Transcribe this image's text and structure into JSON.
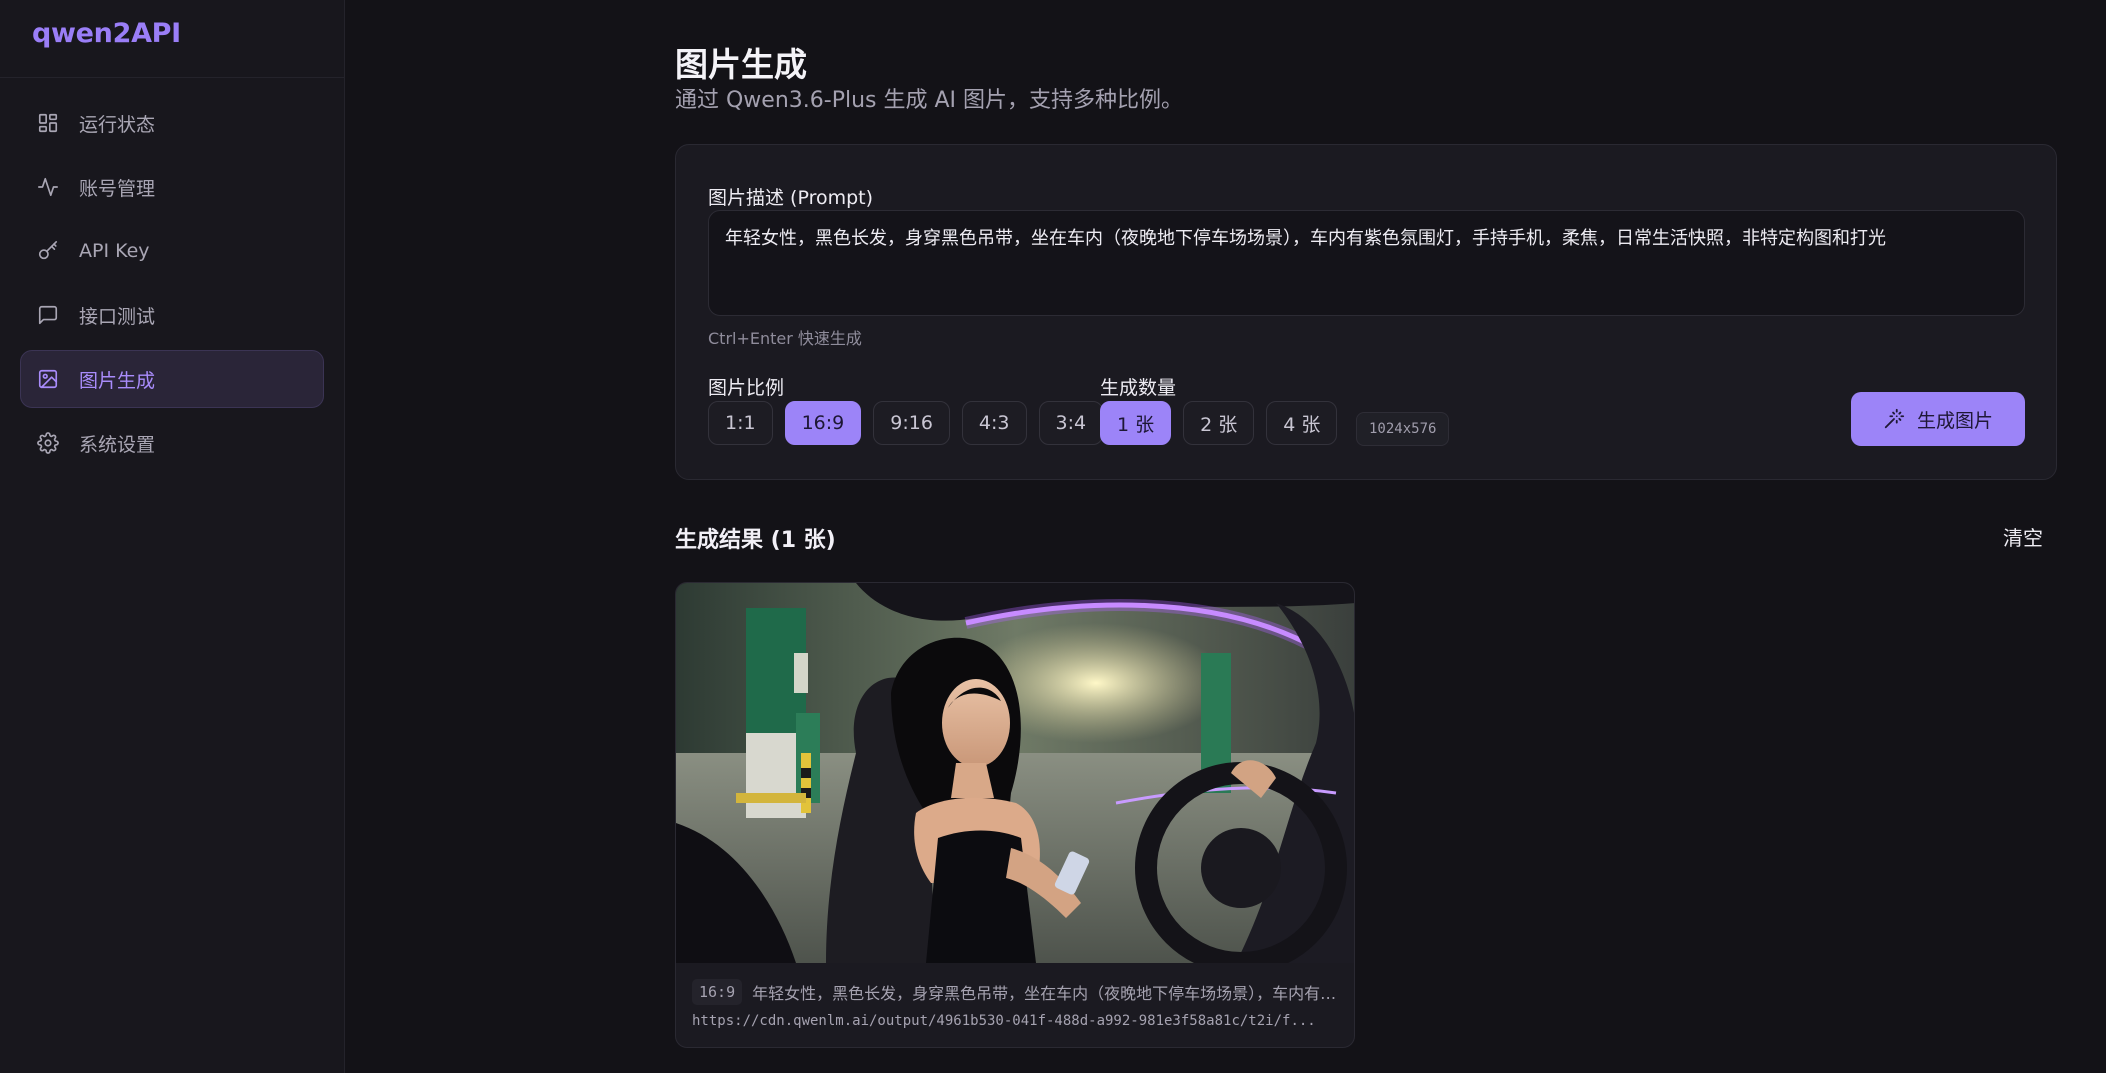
{
  "app": {
    "brand": "qwen2API"
  },
  "sidebar": {
    "items": [
      {
        "label": "运行状态",
        "icon": "dashboard-icon"
      },
      {
        "label": "账号管理",
        "icon": "activity-icon"
      },
      {
        "label": "API Key",
        "icon": "key-icon"
      },
      {
        "label": "接口测试",
        "icon": "message-icon"
      },
      {
        "label": "图片生成",
        "icon": "image-icon",
        "active": true
      },
      {
        "label": "系统设置",
        "icon": "gear-icon"
      }
    ]
  },
  "header": {
    "title": "图片生成",
    "subtitle": "通过 Qwen3.6-Plus 生成 AI 图片，支持多种比例。"
  },
  "form": {
    "prompt_label": "图片描述 (Prompt)",
    "prompt_value": "年轻女性，黑色长发，身穿黑色吊带，坐在车内（夜晚地下停车场场景），车内有紫色氛围灯，手持手机，柔焦，日常生活快照，非特定构图和打光",
    "hint": "Ctrl+Enter 快速生成",
    "ratio_label": "图片比例",
    "ratios": [
      "1:1",
      "16:9",
      "9:16",
      "4:3",
      "3:4"
    ],
    "selected_ratio": "16:9",
    "count_label": "生成数量",
    "counts": [
      "1 张",
      "2 张",
      "4 张"
    ],
    "selected_count": "1 张",
    "resolution": "1024x576",
    "generate_label": "生成图片"
  },
  "results": {
    "title": "生成结果 (1 张)",
    "clear_label": "清空",
    "items": [
      {
        "ratio": "16:9",
        "prompt": "年轻女性，黑色长发，身穿黑色吊带，坐在车内（夜晚地下停车场场景），车内有紫色氛围灯，手持手机，柔焦，日常生活快照，非特定构图和打光",
        "url": "https://cdn.qwenlm.ai/output/4961b530-041f-488d-a992-981e3f58a81c/t2i/f..."
      }
    ]
  },
  "colors": {
    "accent": "#9c84f8",
    "background": "#131217",
    "sidebar": "#18171d",
    "card": "#1b1a21"
  }
}
